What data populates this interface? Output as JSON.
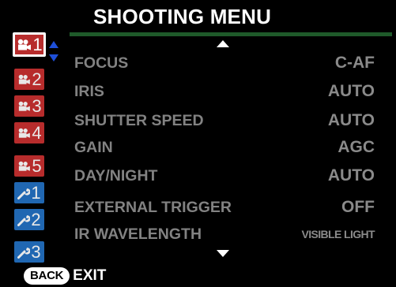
{
  "title": "SHOOTING MENU",
  "tabs": [
    {
      "icon": "movie-camera-icon",
      "number": "1",
      "color": "#b72c2c",
      "selected": true
    },
    {
      "icon": "movie-camera-icon",
      "number": "2",
      "color": "#b72c2c",
      "selected": false
    },
    {
      "icon": "movie-camera-icon",
      "number": "3",
      "color": "#b72c2c",
      "selected": false
    },
    {
      "icon": "movie-camera-icon",
      "number": "4",
      "color": "#b72c2c",
      "selected": false
    },
    {
      "icon": "movie-camera-icon",
      "number": "5",
      "color": "#b72c2c",
      "selected": false
    },
    {
      "icon": "wrench-icon",
      "number": "1",
      "color": "#2067b2",
      "selected": false
    },
    {
      "icon": "wrench-icon",
      "number": "2",
      "color": "#2067b2",
      "selected": false
    },
    {
      "icon": "wrench-icon",
      "number": "3",
      "color": "#2067b2",
      "selected": false
    }
  ],
  "menu": [
    {
      "label": "FOCUS",
      "value": "C-AF"
    },
    {
      "label": "IRIS",
      "value": "AUTO"
    },
    {
      "label": "SHUTTER SPEED",
      "value": "AUTO"
    },
    {
      "label": "GAIN",
      "value": "AGC"
    },
    {
      "label": "DAY/NIGHT",
      "value": "AUTO"
    },
    {
      "label": "EXTERNAL TRIGGER",
      "value": "OFF"
    },
    {
      "label": "IR WAVELENGTH",
      "value": "VISIBLE LIGHT"
    }
  ],
  "footer": {
    "back_label": "BACK",
    "exit_label": "EXIT"
  },
  "colors": {
    "accent_rule": "#1f5a2a",
    "tab_red": "#b72c2c",
    "tab_blue": "#2067b2",
    "scroll_arrows": "#1e4fd8"
  }
}
